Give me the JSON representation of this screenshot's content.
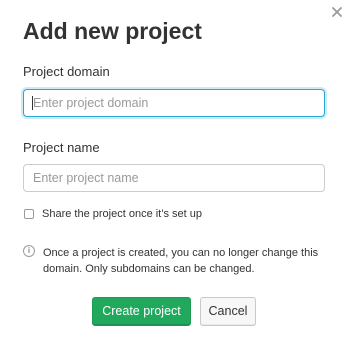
{
  "dialog": {
    "title": "Add new project",
    "close_icon": "close-icon"
  },
  "form": {
    "domain": {
      "label": "Project domain",
      "placeholder": "Enter project domain",
      "value": ""
    },
    "name": {
      "label": "Project name",
      "placeholder": "Enter project name",
      "value": ""
    },
    "share": {
      "label": "Share the project once it’s set up",
      "checked": false
    },
    "notice": {
      "icon": "info-icon",
      "icon_glyph": "i",
      "text": "Once a project is created, you can no longer change this domain. Only subdomains can be changed."
    }
  },
  "actions": {
    "create_label": "Create project",
    "cancel_label": "Cancel"
  },
  "colors": {
    "primary": "#20a85c",
    "focus_border": "#2aa7d8",
    "text": "#333333"
  }
}
